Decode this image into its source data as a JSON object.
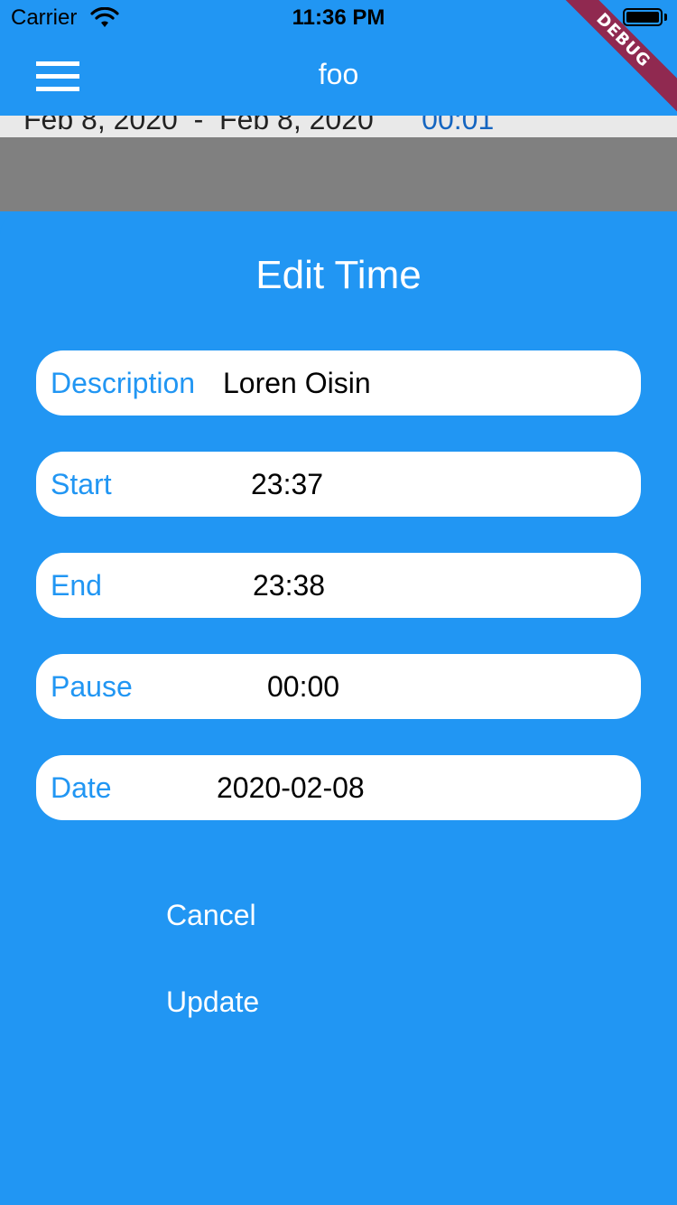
{
  "status_bar": {
    "carrier": "Carrier",
    "time": "11:36 PM"
  },
  "app_bar": {
    "title": "foo",
    "menu_icon": "menu-icon"
  },
  "debug_banner": "DEBUG",
  "background_row": {
    "start_date": "Feb 8, 2020",
    "end_date": "Feb 8, 2020",
    "duration": "00:01"
  },
  "dialog": {
    "title": "Edit Time",
    "fields": {
      "description": {
        "label": "Description",
        "value": "Loren Oisin"
      },
      "start": {
        "label": "Start",
        "value": "23:37"
      },
      "end": {
        "label": "End",
        "value": "23:38"
      },
      "pause": {
        "label": "Pause",
        "value": "00:00"
      },
      "date": {
        "label": "Date",
        "value": "2020-02-08"
      }
    },
    "cancel_label": "Cancel",
    "update_label": "Update"
  },
  "colors": {
    "primary": "#2196f3",
    "field_background": "#ffffff",
    "scrim": "#808080",
    "debug_banner": "#a31633"
  }
}
